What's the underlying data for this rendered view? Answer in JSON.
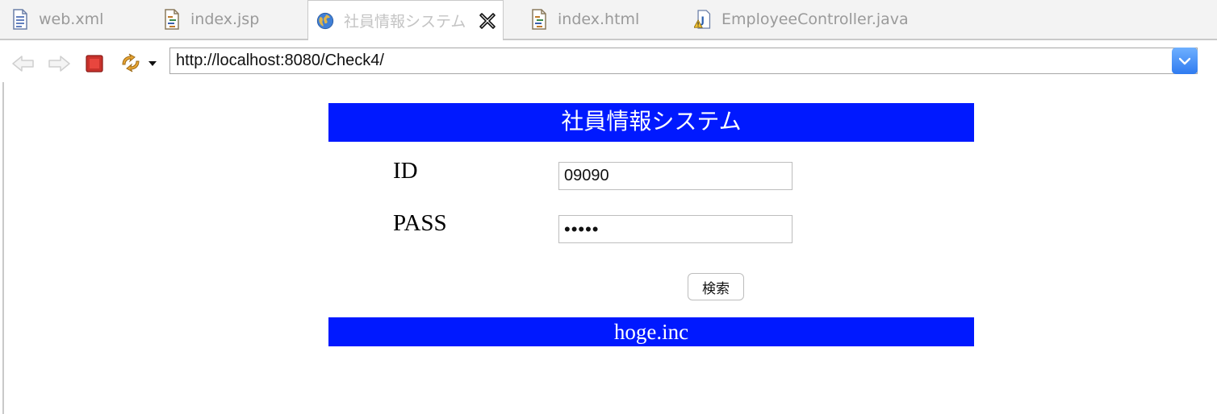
{
  "tabs": [
    {
      "label": "web.xml",
      "icon": "xml-file-icon"
    },
    {
      "label": "index.jsp",
      "icon": "jsp-file-icon"
    },
    {
      "label": "社員情報システム",
      "icon": "globe-icon",
      "active": true
    },
    {
      "label": "index.html",
      "icon": "html-file-icon"
    },
    {
      "label": "EmployeeController.java",
      "icon": "java-file-warning-icon"
    }
  ],
  "toolbar": {
    "back_icon": "back-arrow-icon",
    "forward_icon": "forward-arrow-icon",
    "stop_icon": "stop-icon",
    "refresh_icon": "refresh-icon",
    "url": "http://localhost:8080/Check4/"
  },
  "page": {
    "header_title": "社員情報システム",
    "id_label": "ID",
    "id_value": "09090",
    "pass_label": "PASS",
    "pass_value": "•••••",
    "search_button": "検索",
    "footer": "hoge.inc",
    "banner_color": "#0019ff"
  }
}
